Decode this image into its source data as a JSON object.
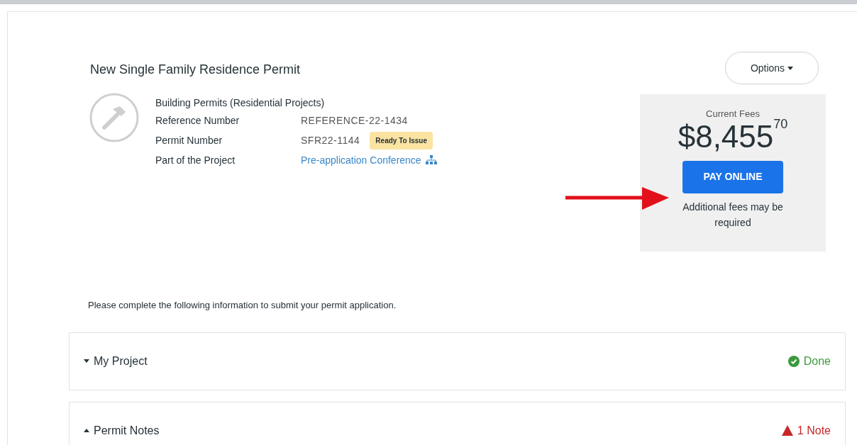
{
  "header": {
    "title": "New Single Family Residence Permit",
    "options_button": "Options"
  },
  "permit": {
    "category": "Building Permits (Residential Projects)",
    "fields": [
      {
        "label": "Reference Number",
        "value": "REFERENCE-22-1434",
        "kind": "text"
      },
      {
        "label": "Permit Number",
        "value": "SFR22-1144",
        "kind": "text",
        "badge": "Ready To Issue"
      },
      {
        "label": "Part of the Project",
        "value": "Pre-application Conference",
        "kind": "link"
      }
    ]
  },
  "fees": {
    "label": "Current Fees",
    "amount": "$8,455",
    "cents": "70",
    "button": "PAY ONLINE",
    "note": "Additional fees may be required"
  },
  "instructions": "Please complete the following information to submit your permit application.",
  "sections": [
    {
      "title": "My Project",
      "expanded": true,
      "status": "Done",
      "kind": "done"
    },
    {
      "title": "Permit Notes",
      "expanded": false,
      "status": "1 Note",
      "kind": "alert"
    }
  ]
}
